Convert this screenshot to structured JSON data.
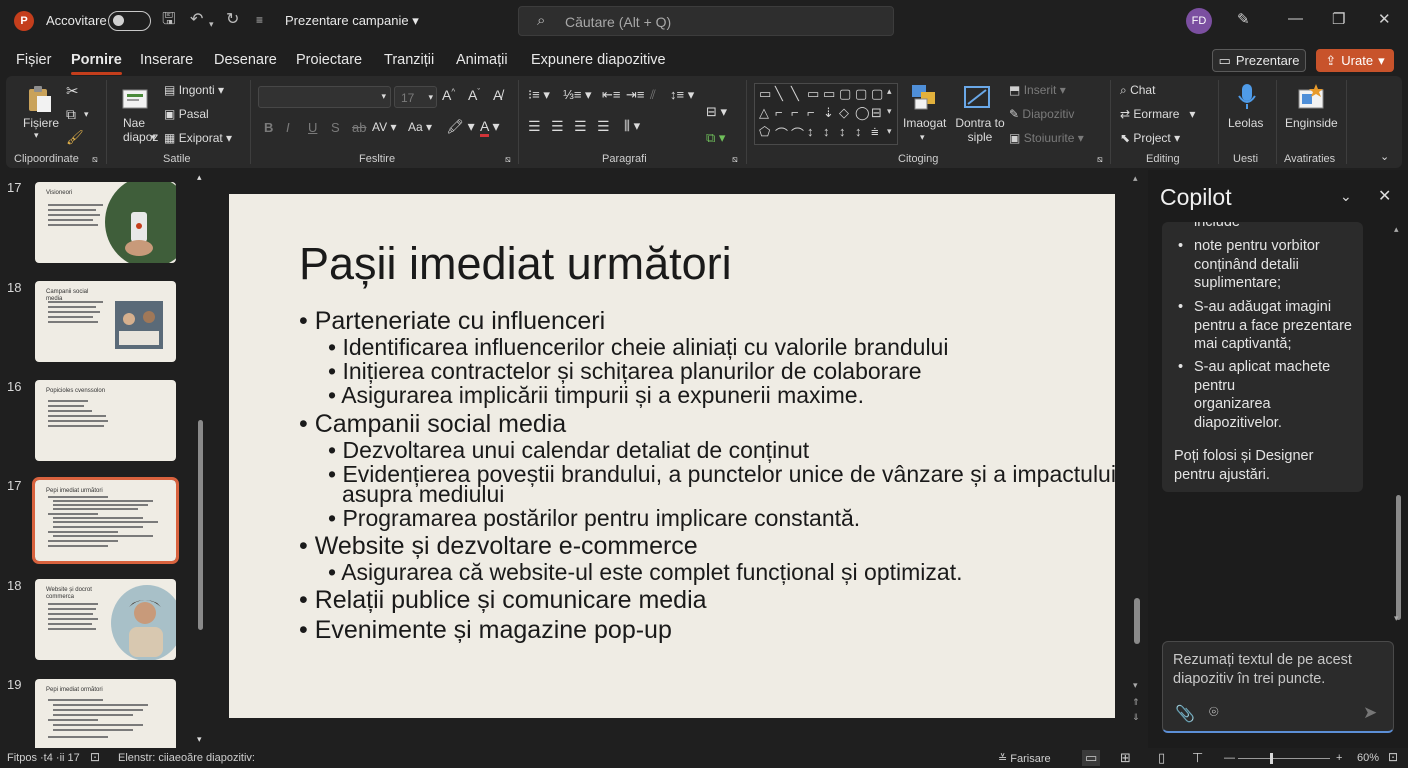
{
  "titlebar": {
    "logo": "P",
    "autosave_label": "Accovitare",
    "doc_title": "Prezentare campanie",
    "search_placeholder": "Căutare (Alt + Q)",
    "avatar": "FD"
  },
  "menu": {
    "tabs": [
      "Fișier",
      "Pornire",
      "Inserare",
      "Desenare",
      "Proiectare",
      "Tranziții",
      "Animații",
      "Expunere diapozitive"
    ],
    "active_tab": "Pornire",
    "present_label": "Prezentare",
    "share_label": "Urate"
  },
  "ribbon": {
    "paste_label": "Fișiere",
    "new_slide_label": "Nae diapoz",
    "layout_label": "Ingonti",
    "reset_label": "Pasal",
    "section_label": "Exiporat",
    "font_size": "17",
    "chat_label": "Chat",
    "format_label": "Eormare",
    "project_label": "Project",
    "insert_label": "Inserit",
    "replace_label": "Diapozitiv",
    "select_label": "Stoiuurite",
    "arrange_label": "Imaogat",
    "quick_styles_label": "Dontra to siple",
    "dictate_label": "Leolas",
    "designer_label": "Enginside",
    "groups": {
      "clipboard": "Clipoordinate",
      "slides": "Satile",
      "font": "Fesltire",
      "paragraph": "Paragrafi",
      "drawing": "Citoging",
      "editing": "Editing",
      "voice": "Uesti",
      "designer": "Avatiraties"
    }
  },
  "thumbnails": [
    {
      "num": "17",
      "title": "Visioneori",
      "selected": false
    },
    {
      "num": "18",
      "title": "Campanii social media",
      "selected": false
    },
    {
      "num": "16",
      "title": "Popicioles cvenssolon",
      "selected": false
    },
    {
      "num": "17",
      "title": "Pepi imediat următori",
      "selected": true
    },
    {
      "num": "18",
      "title": "Website și docrot commerca",
      "selected": false
    },
    {
      "num": "19",
      "title": "Pepi imediat ormători",
      "selected": false
    }
  ],
  "slide": {
    "title": "Pașii imediat următori",
    "bullets": [
      "Parteneriate cu influenceri",
      "Identificarea influencerilor cheie aliniați cu valorile brandului",
      "Inițierea contractelor și schițarea planurilor de colaborare",
      "Asigurarea implicării timpurii și a expunerii maxime.",
      "Campanii social media",
      "Dezvoltarea unui calendar detaliat de conținut",
      "Evidențierea poveștii brandului, a punctelor unice de vânzare și a impactului",
      "asupra mediului",
      "Programarea postărilor pentru implicare constantă.",
      "Website și dezvoltare e-commerce",
      "Asigurarea că website-ul este complet funcțional și optimizat.",
      "Relații publice și comunicare media",
      "Evenimente și magazine pop-up"
    ]
  },
  "copilot": {
    "title": "Copilot",
    "partial_line": "include",
    "items": [
      "note pentru vorbitor conținând detalii suplimentare;",
      "S-au adăugat imagini pentru a face prezentare mai captivantă;",
      "S-au aplicat machete pentru organizarea diapozitivelor."
    ],
    "item_lines": [
      [
        "note pentru vorbitor",
        "conținând detalii",
        "suplimentare;"
      ],
      [
        "S-au adăugat imagini",
        "pentru a face prezentare",
        "mai captivantă;"
      ],
      [
        "S-au aplicat machete",
        "pentru",
        "organizarea",
        "diapozitivelor."
      ]
    ],
    "footer_lines": [
      "Poți folosi și Designer",
      "pentru ajustări."
    ],
    "input_lines": [
      "Rezumați textul de pe acest",
      "diapozitiv în trei puncte."
    ]
  },
  "statusbar": {
    "slide_info": "Fitpos ·t4 ·ii 17",
    "accessibility": "Elenstr: ciiaeoăre diapozitiv:",
    "notes_label": "Farisare",
    "zoom": "60%"
  },
  "colors": {
    "accent": "#c43e1c",
    "share": "#c8532b",
    "slide_bg": "#efece4",
    "selection": "#d8623e"
  }
}
